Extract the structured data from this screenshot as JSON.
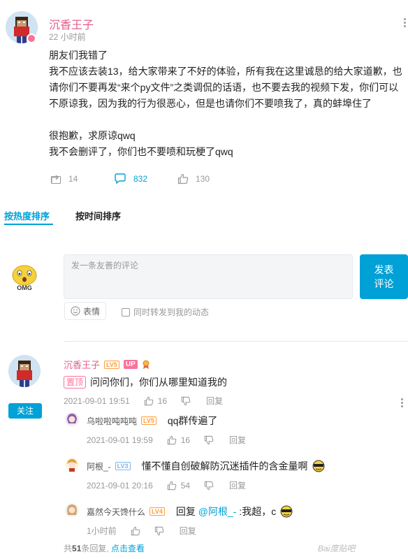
{
  "post": {
    "author": "沉香王子",
    "time": "22 小时前",
    "paragraphs": [
      "朋友们我错了",
      "我不应该去装13，给大家带来了不好的体验，所有我在这里诚恳的给大家道歉，也请你们不要再发“来个py文件”之类调侃的话语，也不要去我的视频下发，你们可以不原谅我，因为我的行为很恶心，但是也请你们不要喷我了，真的蚌埠住了",
      "很抱歉，求原谅qwq",
      "我不会删评了，你们也不要喷和玩梗了qwq"
    ],
    "stats": {
      "forward": "14",
      "comments": "832",
      "likes": "130"
    }
  },
  "tabs": [
    {
      "label": "按热度排序",
      "active": true
    },
    {
      "label": "按时间排序",
      "active": false
    }
  ],
  "composer": {
    "placeholder": "发一条友善的评论",
    "submit_line1": "发表",
    "submit_line2": "评论",
    "emoji_label": "表情",
    "forward_label": "同时转发到我的动态",
    "avatar_label": "OMG"
  },
  "comment": {
    "author": "沉香王子",
    "level": "LV5",
    "up_badge": "UP",
    "pin_badge": "置顶",
    "text": "问问你们，你们从哪里知道我的",
    "time": "2021-09-01 19:51",
    "likes": "16",
    "reply_label": "回复",
    "follow_label": "关注"
  },
  "replies": [
    {
      "author": "乌啦啦吨吨吨",
      "level": "LV5",
      "text": "qq群传遍了",
      "time": "2021-09-01 19:59",
      "likes": "16",
      "reply_label": "回复"
    },
    {
      "author": "阿根_-",
      "level": "LV3",
      "text": "懂不懂自创破解防沉迷插件的含金量啊",
      "time": "2021-09-01 20:16",
      "likes": "54",
      "reply_label": "回复"
    },
    {
      "author": "嘉然今天馋什么",
      "level": "LV4",
      "prefix": "回复 ",
      "mention": "@阿根_-",
      "text": " :我超，c",
      "time": "1小时前",
      "likes": "",
      "reply_label": "回复"
    }
  ],
  "footer": {
    "total_prefix": "共",
    "total_count": "51",
    "total_suffix": "条回复, ",
    "view_more": "点击查看"
  },
  "watermark": "Bai度贴吧"
}
